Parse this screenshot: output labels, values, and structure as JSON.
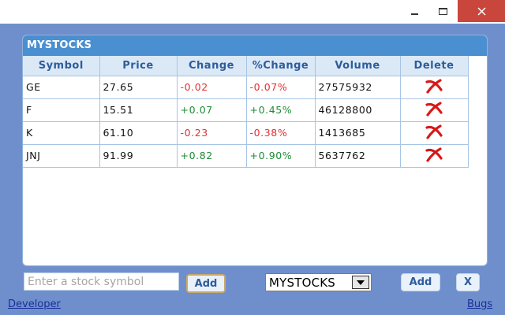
{
  "window": {
    "controls": {
      "minimize_icon": "minimize-icon",
      "maximize_icon": "maximize-icon",
      "close_icon": "close-icon"
    }
  },
  "panel": {
    "title": "MYSTOCKS",
    "columns": [
      "Symbol",
      "Price",
      "Change",
      "%Change",
      "Volume",
      "Delete"
    ],
    "rows": [
      {
        "symbol": "GE",
        "price": "27.65",
        "change": "-0.02",
        "pct_change": "-0.07%",
        "volume": "27575932",
        "direction": "down"
      },
      {
        "symbol": "F",
        "price": "15.51",
        "change": "+0.07",
        "pct_change": "+0.45%",
        "volume": "46128800",
        "direction": "up"
      },
      {
        "symbol": "K",
        "price": "61.10",
        "change": "-0.23",
        "pct_change": "-0.38%",
        "volume": "1413685",
        "direction": "down"
      },
      {
        "symbol": "JNJ",
        "price": "91.99",
        "change": "+0.82",
        "pct_change": "+0.90%",
        "volume": "5637762",
        "direction": "up"
      }
    ],
    "delete_icon": "delete-x-icon"
  },
  "controls": {
    "symbol_input": {
      "placeholder": "Enter a stock symbol",
      "value": ""
    },
    "add_symbol_label": "Add",
    "list_select_value": "MYSTOCKS",
    "add_list_label": "Add",
    "remove_list_label": "X"
  },
  "footer": {
    "developer_link": "Developer",
    "bugs_link": "Bugs"
  },
  "colors": {
    "positive": "#1f8c36",
    "negative": "#e03030",
    "header_bg": "#4a8fd0",
    "background": "#6f8fcc",
    "close_button": "#c9463d"
  }
}
